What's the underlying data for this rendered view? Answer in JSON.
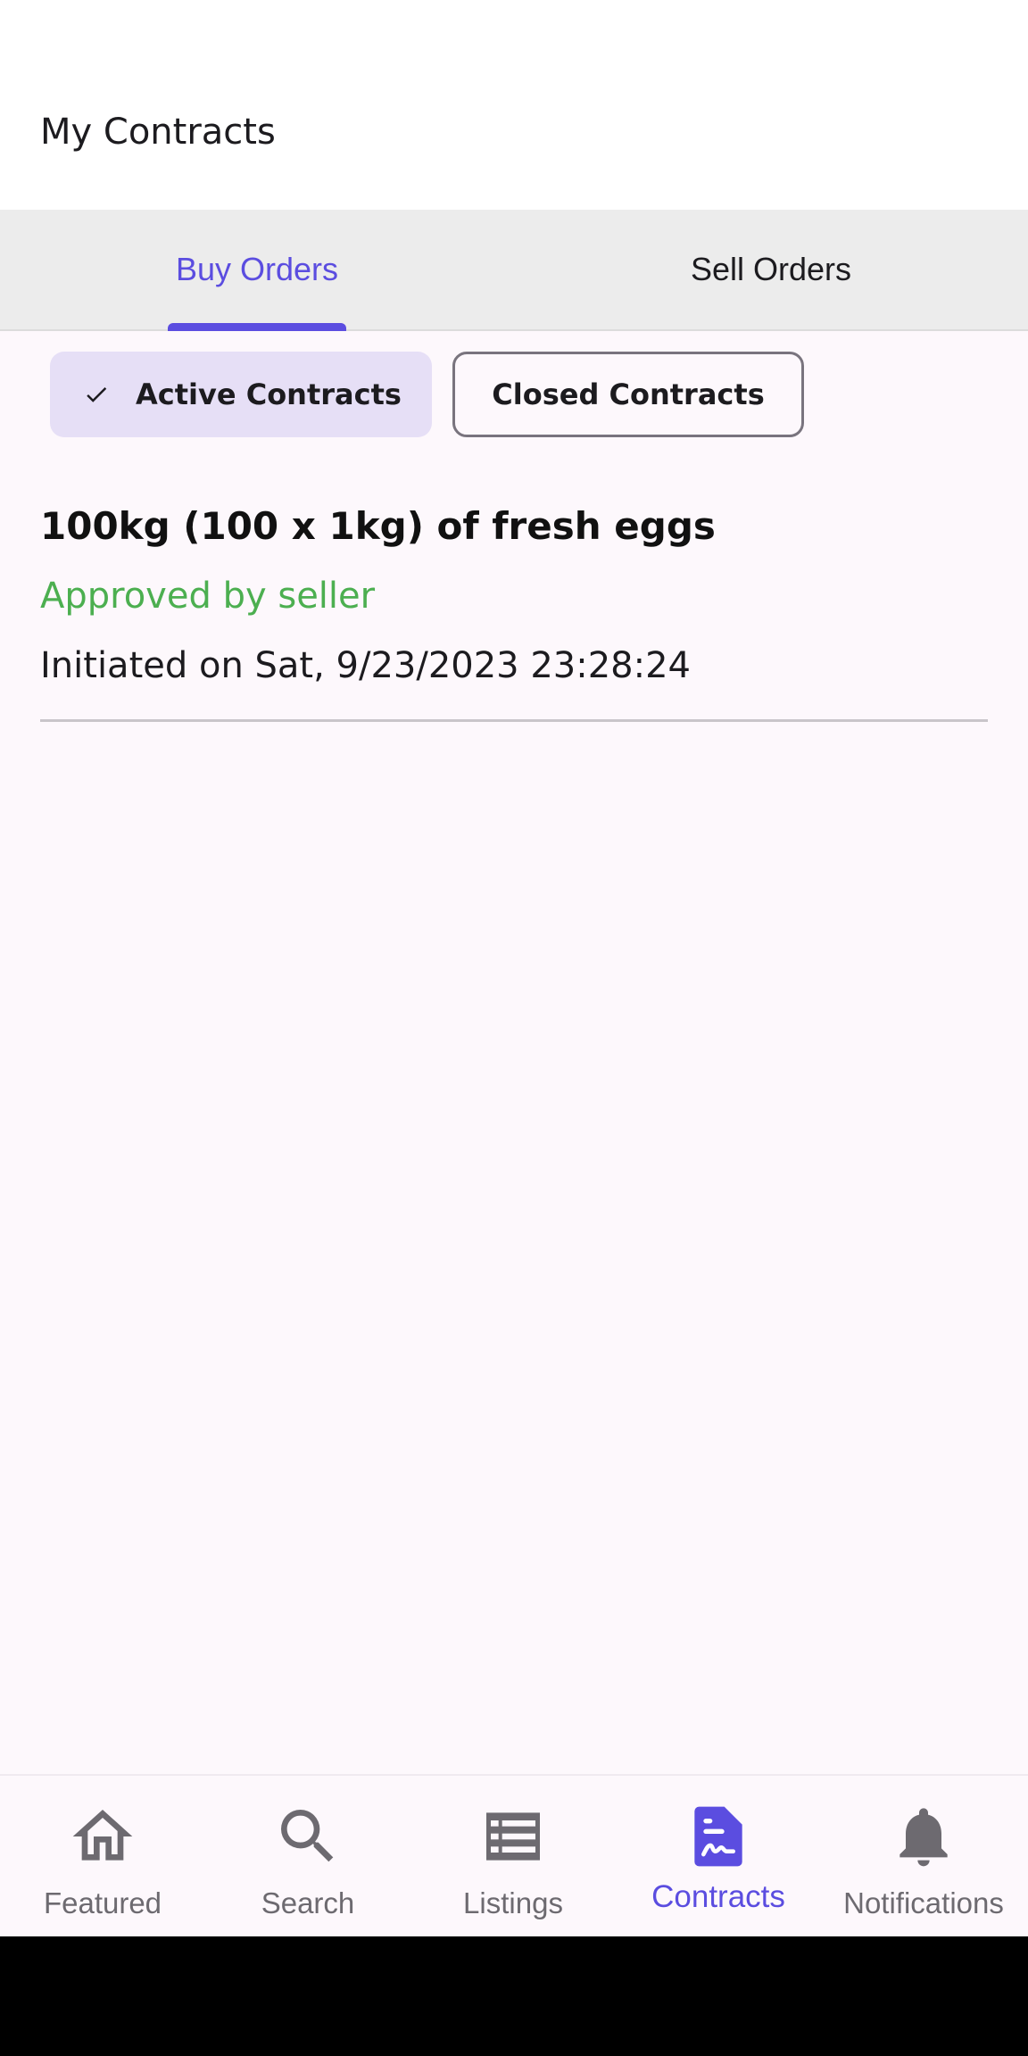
{
  "appbar": {
    "title": "My Contracts"
  },
  "tabs": [
    {
      "label": "Buy Orders",
      "active": true
    },
    {
      "label": "Sell Orders",
      "active": false
    }
  ],
  "filters": {
    "active_label": "Active Contracts",
    "closed_label": "Closed Contracts"
  },
  "contracts": [
    {
      "title": "100kg (100 x 1kg) of fresh eggs",
      "status": "Approved by seller",
      "initiated": "Initiated on Sat, 9/23/2023 23:28:24"
    }
  ],
  "bottom_nav": {
    "items": [
      {
        "label": "Featured",
        "icon": "home-icon"
      },
      {
        "label": "Search",
        "icon": "search-icon"
      },
      {
        "label": "Listings",
        "icon": "list-icon"
      },
      {
        "label": "Contracts",
        "icon": "contract-icon",
        "active": true
      },
      {
        "label": "Notifications",
        "icon": "bell-icon"
      }
    ]
  },
  "colors": {
    "accent": "#5b4de0",
    "status_approved": "#4caf50",
    "chip_selected": "#e6dff6",
    "background": "#fdf8fc"
  }
}
